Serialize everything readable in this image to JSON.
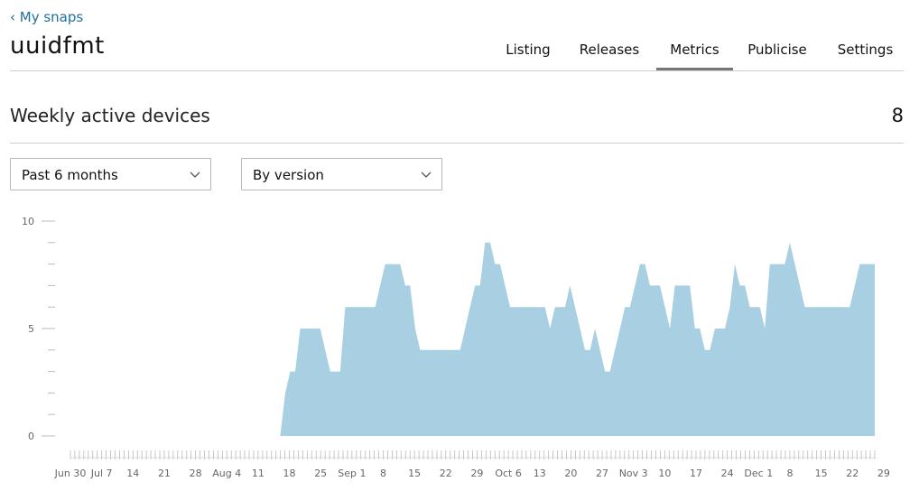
{
  "nav": {
    "back_label": "‹ My snaps"
  },
  "snap": {
    "name": "uuidfmt"
  },
  "tabs": [
    {
      "label": "Listing",
      "active": false
    },
    {
      "label": "Releases",
      "active": false
    },
    {
      "label": "Metrics",
      "active": true
    },
    {
      "label": "Publicise",
      "active": false
    },
    {
      "label": "Settings",
      "active": false
    }
  ],
  "metric": {
    "title": "Weekly active devices",
    "value": "8"
  },
  "filters": {
    "period": "Past 6 months",
    "group_by": "By version"
  },
  "colors": {
    "area_fill": "#a9cfe3",
    "accent": "#1f6f9f",
    "rule": "#cfcfcf"
  },
  "icons": {
    "select_arrow": "chevron-down-icon"
  },
  "chart_data": {
    "type": "area",
    "ylim": [
      0,
      10
    ],
    "yticks": [
      0,
      5,
      10
    ],
    "x_tick_labels": [
      "Jun 30",
      "Jul 7",
      "14",
      "21",
      "28",
      "Aug 4",
      "11",
      "18",
      "25",
      "Sep 1",
      "8",
      "15",
      "22",
      "29",
      "Oct 6",
      "13",
      "20",
      "27",
      "Nov 3",
      "10",
      "17",
      "24",
      "Dec 1",
      "8",
      "15",
      "22",
      "29"
    ],
    "x_start": "Jun 30",
    "values": [
      0,
      0,
      0,
      0,
      0,
      0,
      0,
      0,
      0,
      0,
      0,
      0,
      0,
      0,
      0,
      0,
      0,
      0,
      0,
      0,
      0,
      0,
      0,
      0,
      0,
      0,
      0,
      0,
      0,
      0,
      0,
      0,
      0,
      0,
      0,
      0,
      0,
      0,
      0,
      0,
      0,
      0,
      0,
      2,
      3,
      3,
      5,
      5,
      5,
      5,
      5,
      4,
      3,
      3,
      3,
      6,
      6,
      6,
      6,
      6,
      6,
      6,
      7,
      8,
      8,
      8,
      8,
      7,
      7,
      5,
      4,
      4,
      4,
      4,
      4,
      4,
      4,
      4,
      4,
      5,
      6,
      7,
      7,
      9,
      9,
      8,
      8,
      7,
      6,
      6,
      6,
      6,
      6,
      6,
      6,
      6,
      5,
      6,
      6,
      6,
      7,
      6,
      5,
      4,
      4,
      5,
      4,
      3,
      3,
      4,
      5,
      6,
      6,
      7,
      8,
      8,
      7,
      7,
      7,
      6,
      5,
      7,
      7,
      7,
      7,
      5,
      5,
      4,
      4,
      5,
      5,
      5,
      6,
      8,
      7,
      7,
      6,
      6,
      6,
      5,
      8,
      8,
      8,
      8,
      9,
      8,
      7,
      6,
      6,
      6,
      6,
      6,
      6,
      6,
      6,
      6,
      6,
      7,
      8,
      8,
      8,
      8
    ]
  }
}
